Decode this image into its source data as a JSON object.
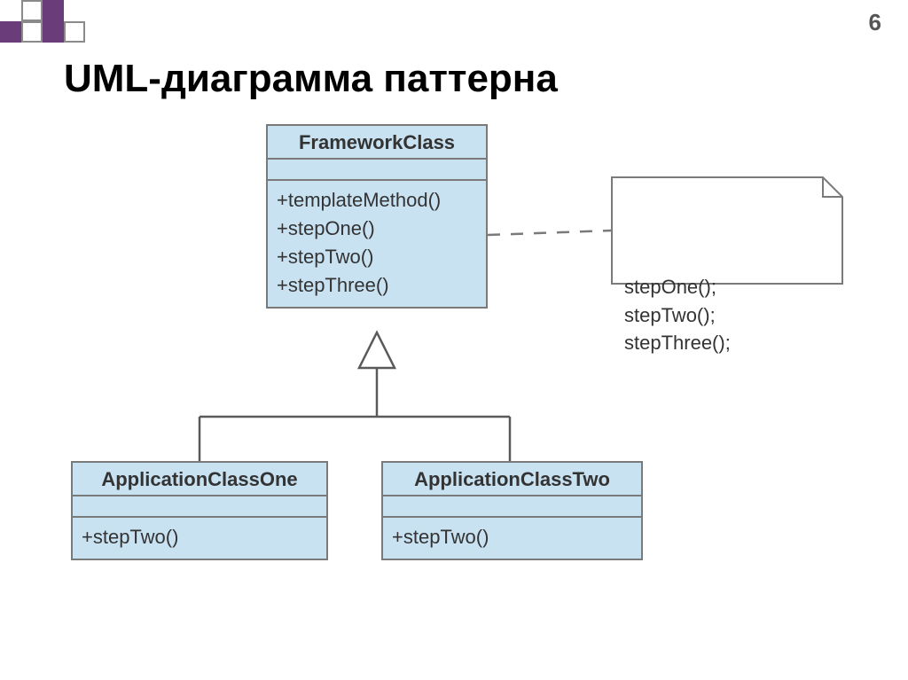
{
  "page_number": "6",
  "title": "UML-диаграмма паттерна",
  "classes": {
    "framework": {
      "name": "FrameworkClass",
      "ops": "+templateMethod()\n+stepOne()\n+stepTwo()\n+stepThree()"
    },
    "app_one": {
      "name": "ApplicationClassOne",
      "ops": "+stepTwo()"
    },
    "app_two": {
      "name": "ApplicationClassTwo",
      "ops": "+stepTwo()"
    }
  },
  "note": {
    "body": "stepOne();\nstepTwo();\nstepThree();"
  }
}
